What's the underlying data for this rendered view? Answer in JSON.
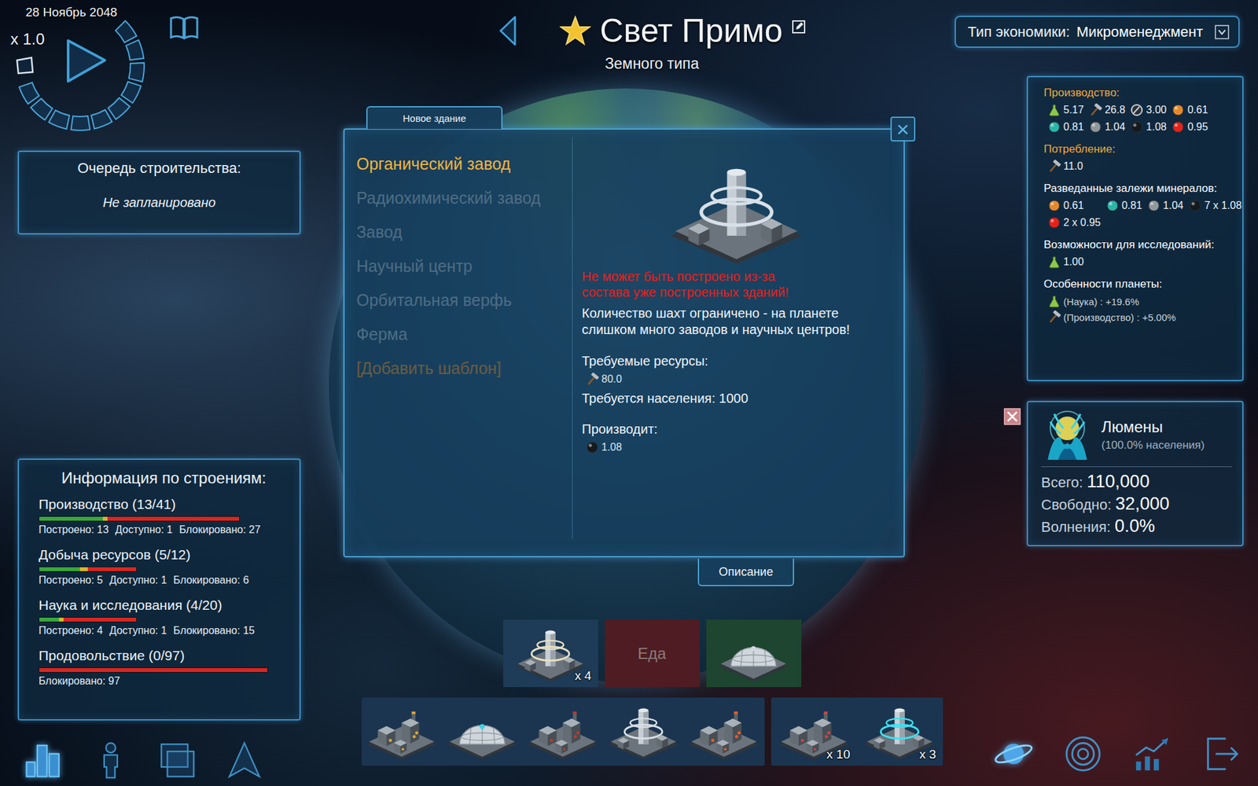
{
  "hud": {
    "date": "28 Ноябрь 2048",
    "speed": "x 1.0"
  },
  "planet": {
    "name": "Свет Примо",
    "type": "Земного типа",
    "favorite": true
  },
  "economy": {
    "label": "Тип экономики:",
    "value": "Микроменеджмент"
  },
  "build_queue": {
    "title": "Очередь строительства:",
    "status": "Не запланировано"
  },
  "building_info": {
    "title": "Информация по строениям:",
    "categories": [
      {
        "name": "Производство (13/41)",
        "track": 0.877,
        "segments": [
          {
            "level": 0.317,
            "color": "#39a83a"
          },
          {
            "level": 0.024,
            "color": "#d9b52a"
          },
          {
            "level": 0.659,
            "color": "#d9261f"
          }
        ],
        "stats": [
          "Построено: 13",
          "Доступно: 1",
          "Блокировано: 27"
        ]
      },
      {
        "name": "Добыча ресурсов (5/12)",
        "track": 0.428,
        "segments": [
          {
            "level": 0.417,
            "color": "#39a83a"
          },
          {
            "level": 0.083,
            "color": "#d9b52a"
          },
          {
            "level": 0.5,
            "color": "#d9261f"
          }
        ],
        "stats": [
          "Построено: 5",
          "Доступно: 1",
          "Блокировано: 6"
        ]
      },
      {
        "name": "Наука и исследования (4/20)",
        "track": 0.428,
        "segments": [
          {
            "level": 0.2,
            "color": "#39a83a"
          },
          {
            "level": 0.05,
            "color": "#d9b52a"
          },
          {
            "level": 0.75,
            "color": "#d9261f"
          }
        ],
        "stats": [
          "Построено: 4",
          "Доступно: 1",
          "Блокировано: 15"
        ]
      },
      {
        "name": "Продовольствие (0/97)",
        "track": 1.0,
        "segments": [
          {
            "level": 1.0,
            "color": "#d9261f"
          }
        ],
        "stats": [
          "Блокировано: 97"
        ]
      }
    ]
  },
  "left_nav": [
    {
      "kind": "buildings",
      "selected": true
    },
    {
      "kind": "population",
      "selected": false
    },
    {
      "kind": "windows",
      "selected": false
    },
    {
      "kind": "fleet",
      "selected": false
    }
  ],
  "dialog": {
    "tab": "Новое здание",
    "close": "×",
    "items": [
      {
        "label": "Органический завод",
        "selected": true,
        "kind": "building"
      },
      {
        "label": "Радиохимический завод",
        "selected": false,
        "kind": "building"
      },
      {
        "label": "Завод",
        "selected": false,
        "kind": "building"
      },
      {
        "label": "Научный центр",
        "selected": false,
        "kind": "building"
      },
      {
        "label": "Орбитальная верфь",
        "selected": false,
        "kind": "building"
      },
      {
        "label": "Ферма",
        "selected": false,
        "kind": "building"
      },
      {
        "label": "[Добавить шаблон]",
        "selected": false,
        "kind": "template"
      }
    ],
    "image": {
      "kind": "tower",
      "color": "#d7e0e8"
    },
    "details": {
      "error": "Не может быть построено из-за состава уже построенных зданий!",
      "description": "Количество шахт ограничено - на планете слишком много заводов и научных центров!",
      "cost_label": "Требуемые ресурсы:",
      "cost": [
        {
          "kind": "hammer",
          "color": "#b9bec4",
          "value": "80.0"
        }
      ],
      "population": "Требуется населения: 1000",
      "produces_label": "Производит:",
      "produces": [
        {
          "kind": "orb",
          "color": "#15181c",
          "value": "1.08"
        }
      ]
    },
    "button": "Описание"
  },
  "resources": {
    "sections": [
      {
        "title": "Производство:",
        "color": "#f2a83a",
        "kind": "grid",
        "items": [
          {
            "kind": "flask",
            "color": "#8cc84b",
            "value": "5.17"
          },
          {
            "kind": "hammer",
            "color": "#b9bec4",
            "value": "26.8"
          },
          {
            "kind": "dial",
            "color": "#c9ced4",
            "value": "3.00"
          },
          {
            "kind": "orb",
            "color": "#e4892b",
            "value": "0.61"
          },
          {
            "kind": "orb",
            "color": "#2bb5a9",
            "value": "0.81"
          },
          {
            "kind": "orb",
            "color": "#8f969c",
            "value": "1.04"
          },
          {
            "kind": "orb",
            "color": "#15181c",
            "value": "1.08"
          },
          {
            "kind": "orb",
            "color": "#e3221b",
            "value": "0.95"
          }
        ]
      },
      {
        "title": "Потребление:",
        "color": "#f2a83a",
        "kind": "grid",
        "items": [
          {
            "kind": "hammer",
            "color": "#b9bec4",
            "value": "11.0"
          }
        ]
      },
      {
        "title": "Разведанные залежи минералов:",
        "color": "#ffffff",
        "kind": "grid",
        "items": [
          {
            "kind": "orb",
            "color": "#e4892b",
            "value": "0.61"
          },
          {
            "kind": "orb",
            "color": "#2bb5a9",
            "value": "0.81"
          },
          {
            "kind": "orb",
            "color": "#8f969c",
            "value": "1.04"
          },
          {
            "kind": "orb",
            "color": "#15181c",
            "value": "7 x 1.08"
          },
          {
            "kind": "orb",
            "color": "#e3221b",
            "value": "2 x 0.95"
          }
        ]
      },
      {
        "title": "Возможности для исследований:",
        "color": "#ffffff",
        "kind": "grid",
        "items": [
          {
            "kind": "flask",
            "color": "#8cc84b",
            "value": "1.00"
          }
        ]
      },
      {
        "title": "Особенности планеты:",
        "color": "#ffffff",
        "kind": "list",
        "items": [
          {
            "kind": "flask",
            "color": "#8cc84b",
            "value": "(Наука) : +19.6%"
          },
          {
            "kind": "hammer",
            "color": "#b9bec4",
            "value": "(Производство) : +5.00%"
          }
        ]
      }
    ]
  },
  "race": {
    "name": "Люмены",
    "share": "(100.0% населения)",
    "stats": [
      {
        "label": "Всего:",
        "value": "110,000"
      },
      {
        "label": "Свободно:",
        "value": "32,000"
      },
      {
        "label": "Волнения:",
        "value": "0.0%"
      }
    ]
  },
  "right_nav": [
    {
      "kind": "planet",
      "selected": true
    },
    {
      "kind": "galaxy",
      "selected": false
    },
    {
      "kind": "stats",
      "selected": false
    },
    {
      "kind": "exit",
      "selected": false
    }
  ],
  "bottom_bar": {
    "top_row": [
      {
        "kind": "tower",
        "tint": "#1e3b57",
        "color": "#e8e0c0",
        "count": "x 4"
      },
      {
        "kind": "empty",
        "tint": "#4e1c22",
        "color": "#8c7a7c",
        "label": "Еда"
      },
      {
        "kind": "dome",
        "tint": "#1d4530",
        "color": "#d0d8de"
      }
    ],
    "groups": [
      {
        "tint": "#1b3550",
        "cards": [
          {
            "kind": "factory",
            "color": "#e0a830"
          },
          {
            "kind": "dome",
            "color": "#3fd3e6"
          },
          {
            "kind": "factory",
            "color": "#c0392b"
          },
          {
            "kind": "tower",
            "color": "#d8dee4"
          },
          {
            "kind": "factory",
            "color": "#ff5a1f"
          }
        ]
      },
      {
        "tint": "#1b3550",
        "cards": [
          {
            "kind": "factory",
            "color": "#d84040",
            "count": "x 10"
          },
          {
            "kind": "tower",
            "color": "#3fe0f0",
            "count": "x 3"
          }
        ]
      }
    ]
  }
}
